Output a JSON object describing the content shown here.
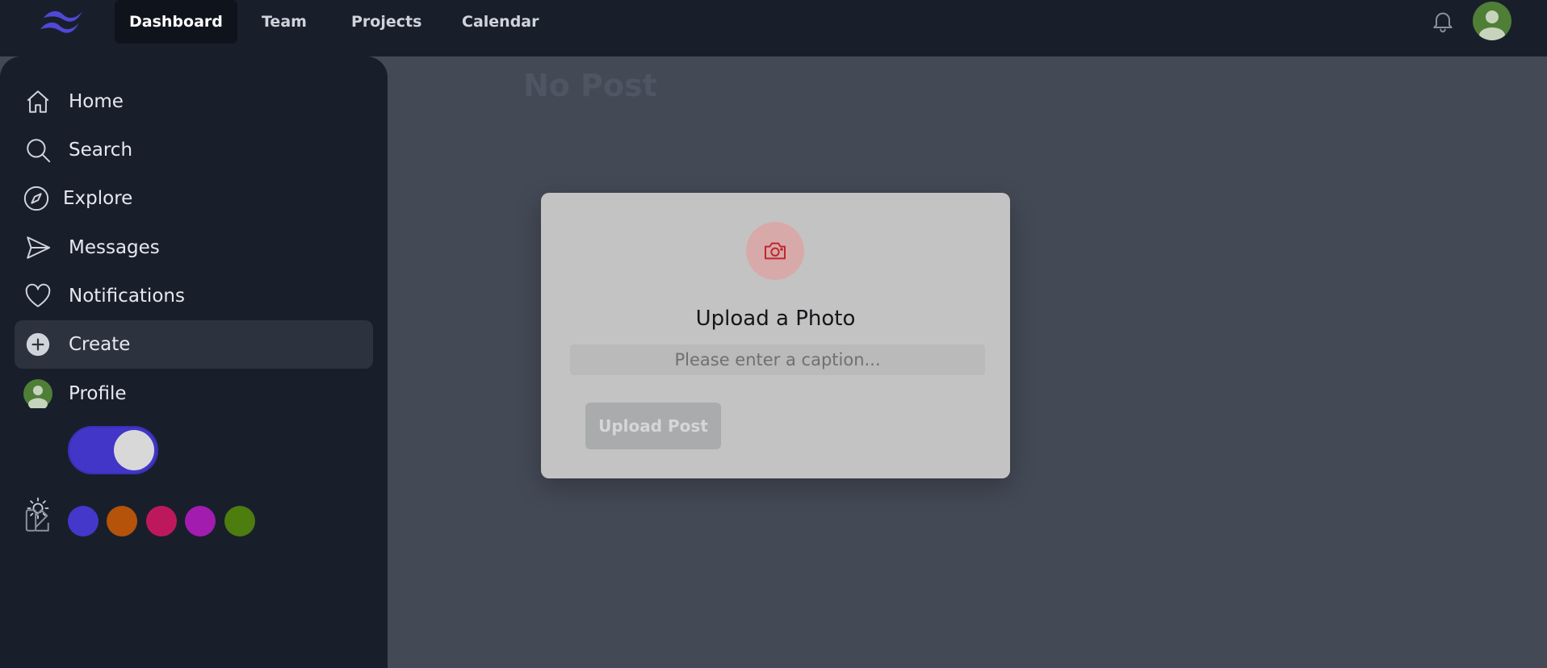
{
  "topnav": {
    "items": [
      {
        "label": "Dashboard",
        "active": true
      },
      {
        "label": "Team",
        "active": false
      },
      {
        "label": "Projects",
        "active": false
      },
      {
        "label": "Calendar",
        "active": false
      }
    ],
    "icons": {
      "logo": "tailwind-logo",
      "notifications": "bell-icon",
      "avatar": "user-avatar"
    }
  },
  "sidebar": {
    "items": [
      {
        "label": "Home",
        "icon": "home-icon"
      },
      {
        "label": "Search",
        "icon": "search-icon"
      },
      {
        "label": "Explore",
        "icon": "compass-icon"
      },
      {
        "label": "Messages",
        "icon": "send-icon"
      },
      {
        "label": "Notifications",
        "icon": "heart-icon"
      },
      {
        "label": "Create",
        "icon": "plus-circle-icon",
        "active": true
      },
      {
        "label": "Profile",
        "icon": "avatar-icon"
      }
    ],
    "theme_toggle": {
      "icon": "sun-icon",
      "state": "on"
    },
    "palette": {
      "icon": "palette-icon",
      "colors": [
        "#4338ca",
        "#b45309",
        "#be185d",
        "#a21caf",
        "#4d7c0f"
      ]
    }
  },
  "main": {
    "empty_title": "No Post"
  },
  "modal": {
    "icon": "camera-icon",
    "title": "Upload a Photo",
    "caption_placeholder": "Please enter a caption...",
    "caption_value": "",
    "submit_label": "Upload Post"
  },
  "colors": {
    "nav_bg": "#181f2b",
    "accent": "#4338ca",
    "modal_bg": "#c3c3c3",
    "camera_red": "#c0272d"
  }
}
